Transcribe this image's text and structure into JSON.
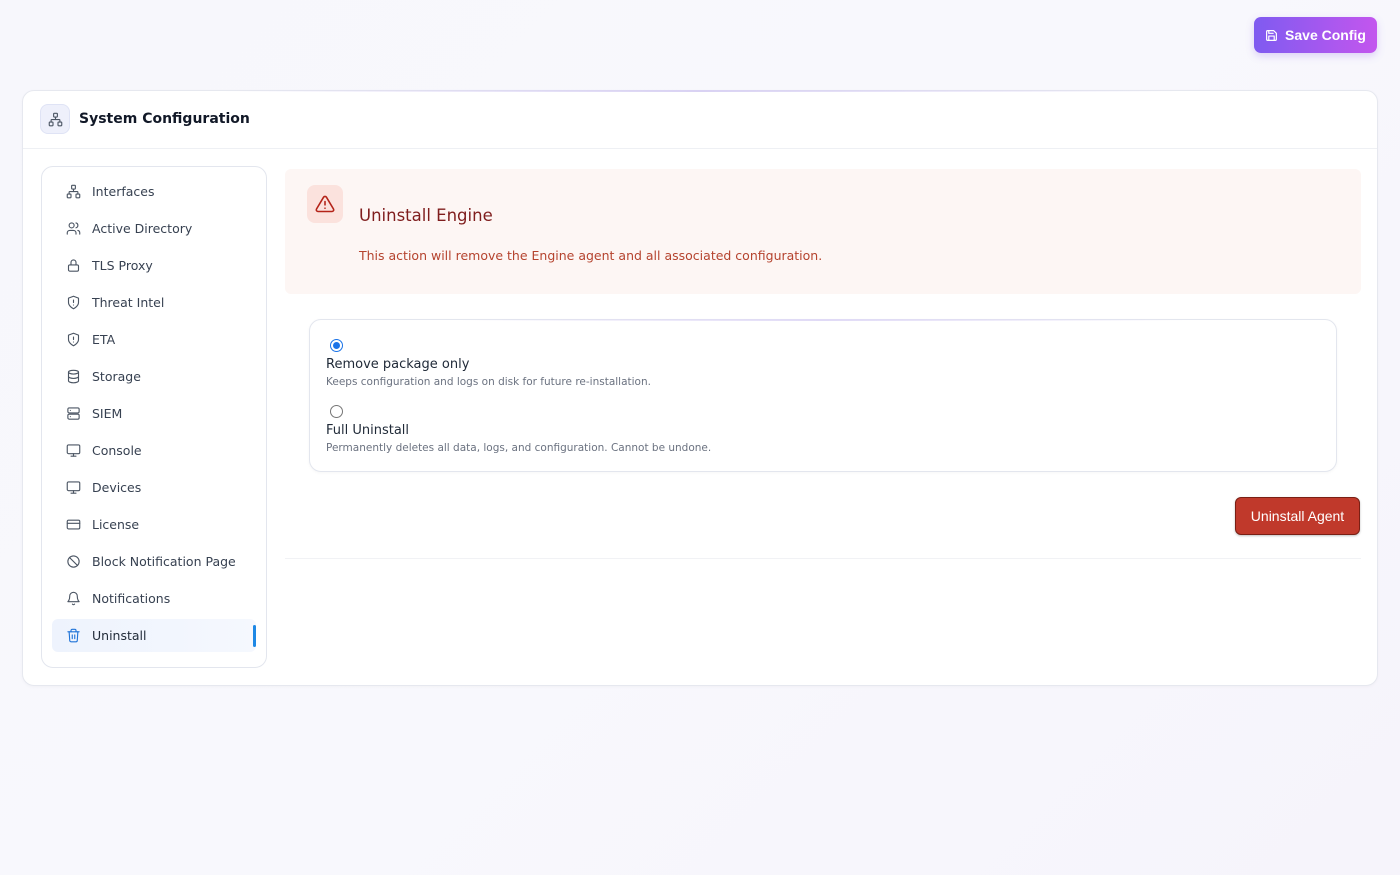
{
  "toolbar": {
    "save_label": "Save Config",
    "save_icon": "floppy-disk-icon"
  },
  "header": {
    "title": "System Configuration",
    "icon": "network-icon"
  },
  "sidebar": {
    "items": [
      {
        "label": "Interfaces",
        "icon": "network-icon"
      },
      {
        "label": "Active Directory",
        "icon": "users-icon"
      },
      {
        "label": "TLS Proxy",
        "icon": "lock-icon"
      },
      {
        "label": "Threat Intel",
        "icon": "shield-alert-icon"
      },
      {
        "label": "ETA",
        "icon": "shield-alert-icon"
      },
      {
        "label": "Storage",
        "icon": "database-icon"
      },
      {
        "label": "SIEM",
        "icon": "server-icon"
      },
      {
        "label": "Console",
        "icon": "monitor-icon"
      },
      {
        "label": "Devices",
        "icon": "monitor-icon"
      },
      {
        "label": "License",
        "icon": "credit-card-icon"
      },
      {
        "label": "Block Notification Page",
        "icon": "ban-icon"
      },
      {
        "label": "Notifications",
        "icon": "bell-icon"
      },
      {
        "label": "Uninstall",
        "icon": "trash-icon",
        "active": true
      }
    ]
  },
  "alert": {
    "title": "Uninstall Engine",
    "description": "This action will remove the Engine agent and all associated configuration.",
    "icon": "warning-triangle-icon"
  },
  "options": [
    {
      "label": "Remove package only",
      "description": "Keeps configuration and logs on disk for future re-installation.",
      "checked": true
    },
    {
      "label": "Full Uninstall",
      "description": "Permanently deletes all data, logs, and configuration. Cannot be undone.",
      "checked": false
    }
  ],
  "actions": {
    "uninstall_label": "Uninstall Agent"
  },
  "colors": {
    "accent_start": "#7f5bf0",
    "accent_end": "#c356ee",
    "danger": "#c0392b",
    "alert_bg": "#fdf6f4",
    "active_indicator": "#1e88e5"
  }
}
